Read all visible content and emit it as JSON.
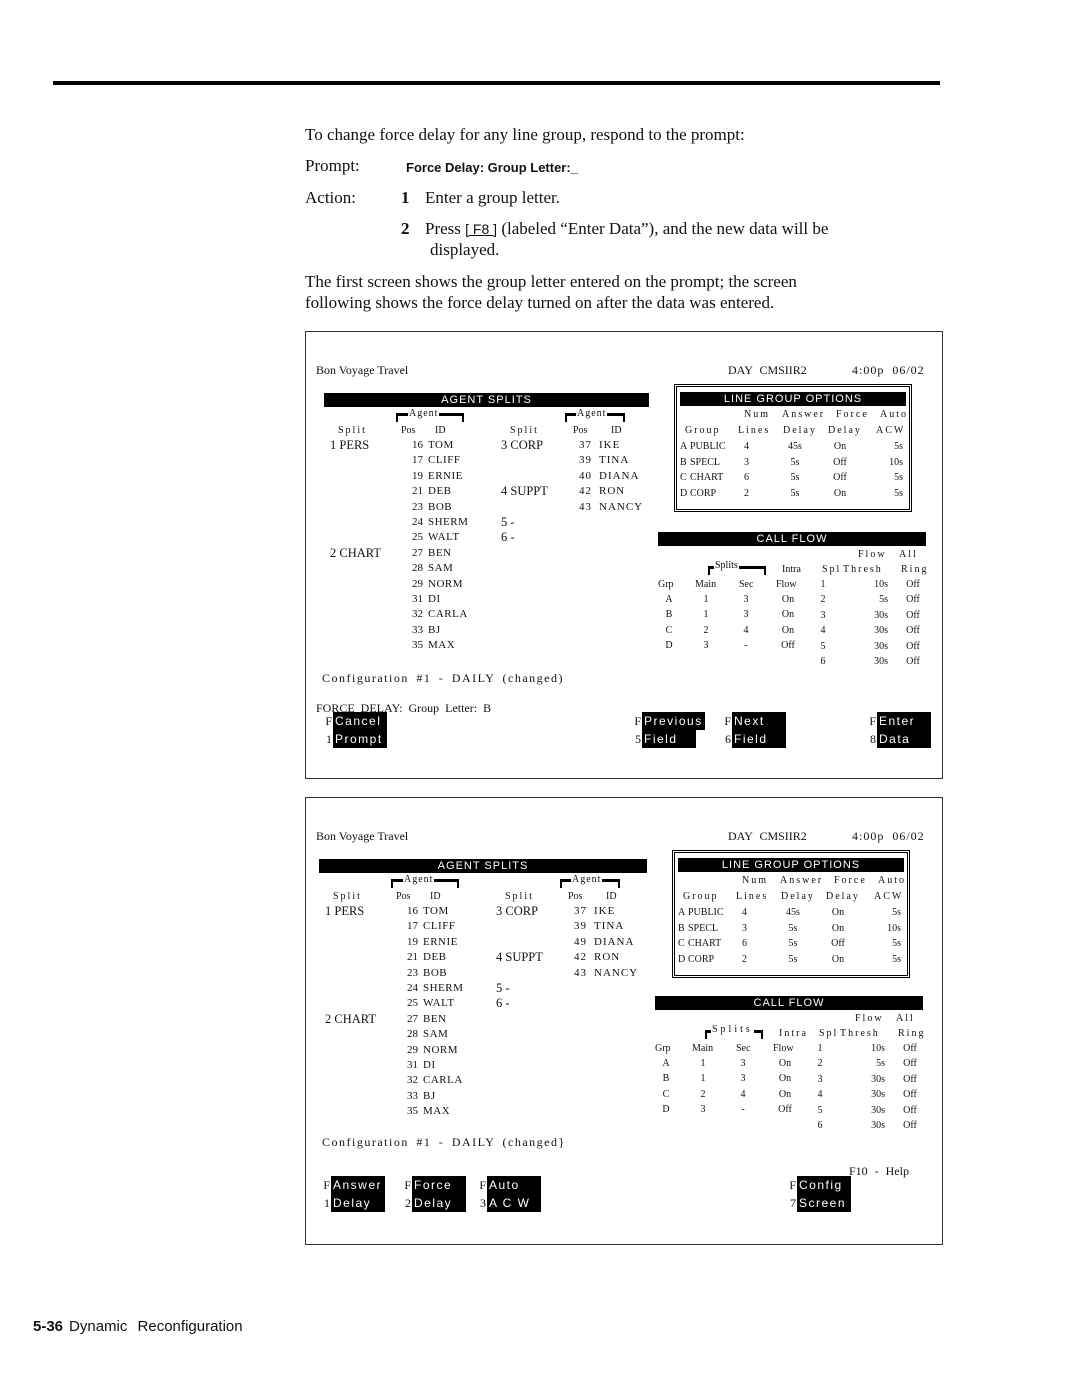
{
  "intro": "To change force delay for any line group, respond to the prompt:",
  "prompt": {
    "label": "Prompt:",
    "command": "Force Delay: Group Letter:_"
  },
  "action": {
    "label": "Action:",
    "steps": [
      {
        "num": "1",
        "text": "Enter a group letter."
      },
      {
        "num": "2",
        "text_before": "Press",
        "key": "[ F8 ]",
        "text_after": "(labeled “Enter Data”), and the new data will be",
        "text_cont": "displayed."
      }
    ]
  },
  "explanation": [
    "The first screen shows the group letter entered on the prompt; the screen",
    "following shows the force delay turned on after the data was entered."
  ],
  "screens": [
    {
      "company": "Bon Voyage Travel",
      "system": "DAY CMSIIR2",
      "time": "4:00p 06/02",
      "agent_splits": {
        "title": "AGENT SPLITS",
        "agent_label": "Agent",
        "split_label": "Split",
        "pos_label": "Pos",
        "id_label": "ID",
        "left_splits": [
          {
            "row": 0,
            "text": "1 PERS"
          },
          {
            "row": 7,
            "text": "2 CHART"
          }
        ],
        "left_agents": [
          [
            "16",
            "TOM"
          ],
          [
            "17",
            "CLIFF"
          ],
          [
            "19",
            "ERNIE"
          ],
          [
            "21",
            "DEB"
          ],
          [
            "23",
            "BOB"
          ],
          [
            "24",
            "SHERM"
          ],
          [
            "25",
            "WALT"
          ],
          [
            "27",
            "BEN"
          ],
          [
            "28",
            "SAM"
          ],
          [
            "29",
            "NORM"
          ],
          [
            "31",
            "DI"
          ],
          [
            "32",
            "CARLA"
          ],
          [
            "33",
            "BJ"
          ],
          [
            "35",
            "MAX"
          ]
        ],
        "right_splits": [
          {
            "row": 0,
            "text": "3 CORP"
          },
          {
            "row": 3,
            "text": "4 SUPPT"
          },
          {
            "row": 5,
            "text": "5 -"
          },
          {
            "row": 6,
            "text": "6 -"
          }
        ],
        "right_agents": [
          [
            "37",
            "IKE"
          ],
          [
            "39",
            "TINA"
          ],
          [
            "40",
            "DIANA"
          ],
          [
            "42",
            "RON"
          ],
          [
            "43",
            "NANCY"
          ]
        ]
      },
      "line_group_options": {
        "title": "LINE GROUP OPTIONS",
        "head1": [
          "Num",
          "Answer",
          "Force",
          "Auto"
        ],
        "head2": [
          "Group",
          "Lines",
          "Delay",
          "Delay",
          "ACW"
        ],
        "rows": [
          [
            "A",
            "PUBLIC",
            "4",
            "45s",
            "On",
            "5s"
          ],
          [
            "B",
            "SPECL",
            "3",
            "5s",
            "Off",
            "10s"
          ],
          [
            "C",
            "CHART",
            "6",
            "5s",
            "Off",
            "5s"
          ],
          [
            "D",
            "CORP",
            "2",
            "5s",
            "On",
            "5s"
          ]
        ]
      },
      "call_flow": {
        "title": "CALL FLOW",
        "head_top": [
          "Flow",
          "All"
        ],
        "splits_label": "Splits",
        "head_mid": [
          "Intra",
          "Spl",
          "Thresh",
          "Ring"
        ],
        "head_bottom": [
          "Grp",
          "Main",
          "Sec",
          "Flow"
        ],
        "group_rows": [
          [
            "A",
            "1",
            "3",
            "On"
          ],
          [
            "B",
            "1",
            "3",
            "On"
          ],
          [
            "C",
            "2",
            "4",
            "On"
          ],
          [
            "D",
            "3",
            "-",
            "Off"
          ]
        ],
        "spl_rows": [
          [
            "1",
            "10s",
            "Off"
          ],
          [
            "2",
            "5s",
            "Off"
          ],
          [
            "3",
            "30s",
            "Off"
          ],
          [
            "4",
            "30s",
            "Off"
          ],
          [
            "5",
            "30s",
            "Off"
          ],
          [
            "6",
            "30s",
            "Off"
          ]
        ]
      },
      "configuration": "Configuration #1 - DAILY (changed)",
      "prompt_line": "FORCE DELAY: Group Letter: B",
      "help": "",
      "function_keys": [
        {
          "num_top": "F",
          "num_bottom": "1",
          "top": "Cancel",
          "bottom": "Prompt"
        },
        {
          "num_top": "F",
          "num_bottom": "5",
          "top": "Previous",
          "bottom": "Field"
        },
        {
          "num_top": "F",
          "num_bottom": "6",
          "top": "Next",
          "bottom": "Field"
        },
        {
          "num_top": "F",
          "num_bottom": "8",
          "top": "Enter",
          "bottom": "Data"
        }
      ]
    },
    {
      "company": "Bon Voyage Travel",
      "system": "DAY CMSIIR2",
      "time": "4:00p 06/02",
      "agent_splits": {
        "title": "AGENT SPLITS",
        "agent_label": "Agent",
        "split_label": "Split",
        "pos_label": "Pos",
        "id_label": "ID",
        "left_splits": [
          {
            "row": 0,
            "text": "1 PERS"
          },
          {
            "row": 7,
            "text": "2 CHART"
          }
        ],
        "left_agents": [
          [
            "16",
            "TOM"
          ],
          [
            "17",
            "CLIFF"
          ],
          [
            "19",
            "ERNIE"
          ],
          [
            "21",
            "DEB"
          ],
          [
            "23",
            "BOB"
          ],
          [
            "24",
            "SHERM"
          ],
          [
            "25",
            "WALT"
          ],
          [
            "27",
            "BEN"
          ],
          [
            "28",
            "SAM"
          ],
          [
            "29",
            "NORM"
          ],
          [
            "31",
            "DI"
          ],
          [
            "32",
            "CARLA"
          ],
          [
            "33",
            "BJ"
          ],
          [
            "35",
            "MAX"
          ]
        ],
        "right_splits": [
          {
            "row": 0,
            "text": "3 CORP"
          },
          {
            "row": 3,
            "text": "4 SUPPT"
          },
          {
            "row": 5,
            "text": "5 -"
          },
          {
            "row": 6,
            "text": "6 -"
          }
        ],
        "right_agents": [
          [
            "37",
            "IKE"
          ],
          [
            "39",
            "TINA"
          ],
          [
            "49",
            "DIANA"
          ],
          [
            "42",
            "RON"
          ],
          [
            "43",
            "NANCY"
          ]
        ]
      },
      "line_group_options": {
        "title": "LINE GROUP OPTIONS",
        "head1": [
          "Num",
          "Answer",
          "Force",
          "Auto"
        ],
        "head2": [
          "Group",
          "Lines",
          "Delay",
          "Delay",
          "ACW"
        ],
        "rows": [
          [
            "A",
            "PUBLIC",
            "4",
            "45s",
            "On",
            "5s"
          ],
          [
            "B",
            "SPECL",
            "3",
            "5s",
            "On",
            "10s"
          ],
          [
            "C",
            "CHART",
            "6",
            "5s",
            "Off",
            "5s"
          ],
          [
            "D",
            "CORP",
            "2",
            "5s",
            "On",
            "5s"
          ]
        ]
      },
      "call_flow": {
        "title": "CALL FLOW",
        "head_top": [
          "Flow",
          "All"
        ],
        "splits_label": "Splits",
        "head_mid": [
          "Intra",
          "Spl",
          "Thresh",
          "Ring"
        ],
        "head_bottom": [
          "Grp",
          "Main",
          "Sec",
          "Flow"
        ],
        "group_rows": [
          [
            "A",
            "1",
            "3",
            "On"
          ],
          [
            "B",
            "1",
            "3",
            "On"
          ],
          [
            "C",
            "2",
            "4",
            "On"
          ],
          [
            "D",
            "3",
            "-",
            "Off"
          ]
        ],
        "spl_rows": [
          [
            "1",
            "10s",
            "Off"
          ],
          [
            "2",
            "5s",
            "Off"
          ],
          [
            "3",
            "30s",
            "Off"
          ],
          [
            "4",
            "30s",
            "Off"
          ],
          [
            "5",
            "30s",
            "Off"
          ],
          [
            "6",
            "30s",
            "Off"
          ]
        ]
      },
      "configuration": "Configuration #1 - DAILY (changed}",
      "prompt_line": "",
      "help": "F10 - Help",
      "function_keys": [
        {
          "num_top": "F",
          "num_bottom": "1",
          "top": "Answer",
          "bottom": "Delay"
        },
        {
          "num_top": "F",
          "num_bottom": "2",
          "top": "Force",
          "bottom": "Delay"
        },
        {
          "num_top": "F",
          "num_bottom": "3",
          "top": "Auto",
          "bottom": "A C W"
        },
        {
          "num_top": "F",
          "num_bottom": "7",
          "top": "Config",
          "bottom": "Screen"
        }
      ]
    }
  ],
  "footer": {
    "page": "5-36",
    "section": "Dynamic Reconfiguration"
  }
}
